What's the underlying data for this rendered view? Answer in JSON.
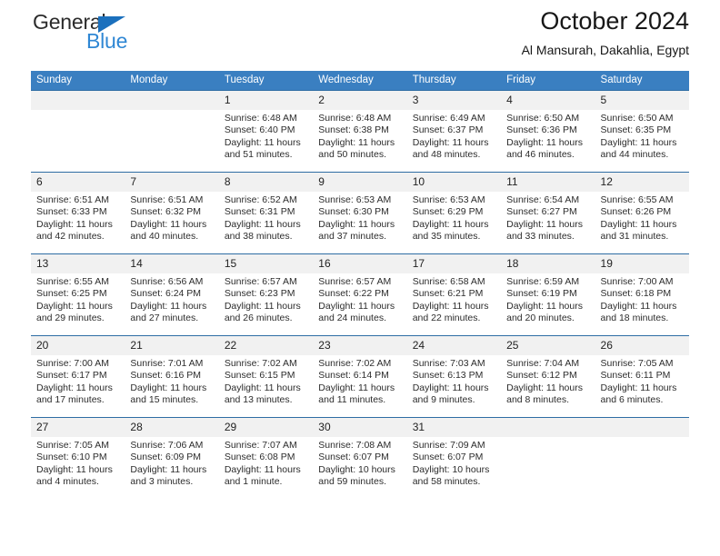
{
  "brand": {
    "name_part1": "General",
    "name_part2": "Blue",
    "triangle_color": "#1b70bd",
    "blue_color": "#2f87d4"
  },
  "header": {
    "title": "October 2024",
    "subtitle": "Al Mansurah, Dakahlia, Egypt",
    "header_bg": "#3a7fc1"
  },
  "weekdays": [
    "Sunday",
    "Monday",
    "Tuesday",
    "Wednesday",
    "Thursday",
    "Friday",
    "Saturday"
  ],
  "weeks": [
    [
      {
        "day": "",
        "lines": []
      },
      {
        "day": "",
        "lines": []
      },
      {
        "day": "1",
        "lines": [
          "Sunrise: 6:48 AM",
          "Sunset: 6:40 PM",
          "Daylight: 11 hours and 51 minutes."
        ]
      },
      {
        "day": "2",
        "lines": [
          "Sunrise: 6:48 AM",
          "Sunset: 6:38 PM",
          "Daylight: 11 hours and 50 minutes."
        ]
      },
      {
        "day": "3",
        "lines": [
          "Sunrise: 6:49 AM",
          "Sunset: 6:37 PM",
          "Daylight: 11 hours and 48 minutes."
        ]
      },
      {
        "day": "4",
        "lines": [
          "Sunrise: 6:50 AM",
          "Sunset: 6:36 PM",
          "Daylight: 11 hours and 46 minutes."
        ]
      },
      {
        "day": "5",
        "lines": [
          "Sunrise: 6:50 AM",
          "Sunset: 6:35 PM",
          "Daylight: 11 hours and 44 minutes."
        ]
      }
    ],
    [
      {
        "day": "6",
        "lines": [
          "Sunrise: 6:51 AM",
          "Sunset: 6:33 PM",
          "Daylight: 11 hours and 42 minutes."
        ]
      },
      {
        "day": "7",
        "lines": [
          "Sunrise: 6:51 AM",
          "Sunset: 6:32 PM",
          "Daylight: 11 hours and 40 minutes."
        ]
      },
      {
        "day": "8",
        "lines": [
          "Sunrise: 6:52 AM",
          "Sunset: 6:31 PM",
          "Daylight: 11 hours and 38 minutes."
        ]
      },
      {
        "day": "9",
        "lines": [
          "Sunrise: 6:53 AM",
          "Sunset: 6:30 PM",
          "Daylight: 11 hours and 37 minutes."
        ]
      },
      {
        "day": "10",
        "lines": [
          "Sunrise: 6:53 AM",
          "Sunset: 6:29 PM",
          "Daylight: 11 hours and 35 minutes."
        ]
      },
      {
        "day": "11",
        "lines": [
          "Sunrise: 6:54 AM",
          "Sunset: 6:27 PM",
          "Daylight: 11 hours and 33 minutes."
        ]
      },
      {
        "day": "12",
        "lines": [
          "Sunrise: 6:55 AM",
          "Sunset: 6:26 PM",
          "Daylight: 11 hours and 31 minutes."
        ]
      }
    ],
    [
      {
        "day": "13",
        "lines": [
          "Sunrise: 6:55 AM",
          "Sunset: 6:25 PM",
          "Daylight: 11 hours and 29 minutes."
        ]
      },
      {
        "day": "14",
        "lines": [
          "Sunrise: 6:56 AM",
          "Sunset: 6:24 PM",
          "Daylight: 11 hours and 27 minutes."
        ]
      },
      {
        "day": "15",
        "lines": [
          "Sunrise: 6:57 AM",
          "Sunset: 6:23 PM",
          "Daylight: 11 hours and 26 minutes."
        ]
      },
      {
        "day": "16",
        "lines": [
          "Sunrise: 6:57 AM",
          "Sunset: 6:22 PM",
          "Daylight: 11 hours and 24 minutes."
        ]
      },
      {
        "day": "17",
        "lines": [
          "Sunrise: 6:58 AM",
          "Sunset: 6:21 PM",
          "Daylight: 11 hours and 22 minutes."
        ]
      },
      {
        "day": "18",
        "lines": [
          "Sunrise: 6:59 AM",
          "Sunset: 6:19 PM",
          "Daylight: 11 hours and 20 minutes."
        ]
      },
      {
        "day": "19",
        "lines": [
          "Sunrise: 7:00 AM",
          "Sunset: 6:18 PM",
          "Daylight: 11 hours and 18 minutes."
        ]
      }
    ],
    [
      {
        "day": "20",
        "lines": [
          "Sunrise: 7:00 AM",
          "Sunset: 6:17 PM",
          "Daylight: 11 hours and 17 minutes."
        ]
      },
      {
        "day": "21",
        "lines": [
          "Sunrise: 7:01 AM",
          "Sunset: 6:16 PM",
          "Daylight: 11 hours and 15 minutes."
        ]
      },
      {
        "day": "22",
        "lines": [
          "Sunrise: 7:02 AM",
          "Sunset: 6:15 PM",
          "Daylight: 11 hours and 13 minutes."
        ]
      },
      {
        "day": "23",
        "lines": [
          "Sunrise: 7:02 AM",
          "Sunset: 6:14 PM",
          "Daylight: 11 hours and 11 minutes."
        ]
      },
      {
        "day": "24",
        "lines": [
          "Sunrise: 7:03 AM",
          "Sunset: 6:13 PM",
          "Daylight: 11 hours and 9 minutes."
        ]
      },
      {
        "day": "25",
        "lines": [
          "Sunrise: 7:04 AM",
          "Sunset: 6:12 PM",
          "Daylight: 11 hours and 8 minutes."
        ]
      },
      {
        "day": "26",
        "lines": [
          "Sunrise: 7:05 AM",
          "Sunset: 6:11 PM",
          "Daylight: 11 hours and 6 minutes."
        ]
      }
    ],
    [
      {
        "day": "27",
        "lines": [
          "Sunrise: 7:05 AM",
          "Sunset: 6:10 PM",
          "Daylight: 11 hours and 4 minutes."
        ]
      },
      {
        "day": "28",
        "lines": [
          "Sunrise: 7:06 AM",
          "Sunset: 6:09 PM",
          "Daylight: 11 hours and 3 minutes."
        ]
      },
      {
        "day": "29",
        "lines": [
          "Sunrise: 7:07 AM",
          "Sunset: 6:08 PM",
          "Daylight: 11 hours and 1 minute."
        ]
      },
      {
        "day": "30",
        "lines": [
          "Sunrise: 7:08 AM",
          "Sunset: 6:07 PM",
          "Daylight: 10 hours and 59 minutes."
        ]
      },
      {
        "day": "31",
        "lines": [
          "Sunrise: 7:09 AM",
          "Sunset: 6:07 PM",
          "Daylight: 10 hours and 58 minutes."
        ]
      },
      {
        "day": "",
        "lines": []
      },
      {
        "day": "",
        "lines": []
      }
    ]
  ]
}
